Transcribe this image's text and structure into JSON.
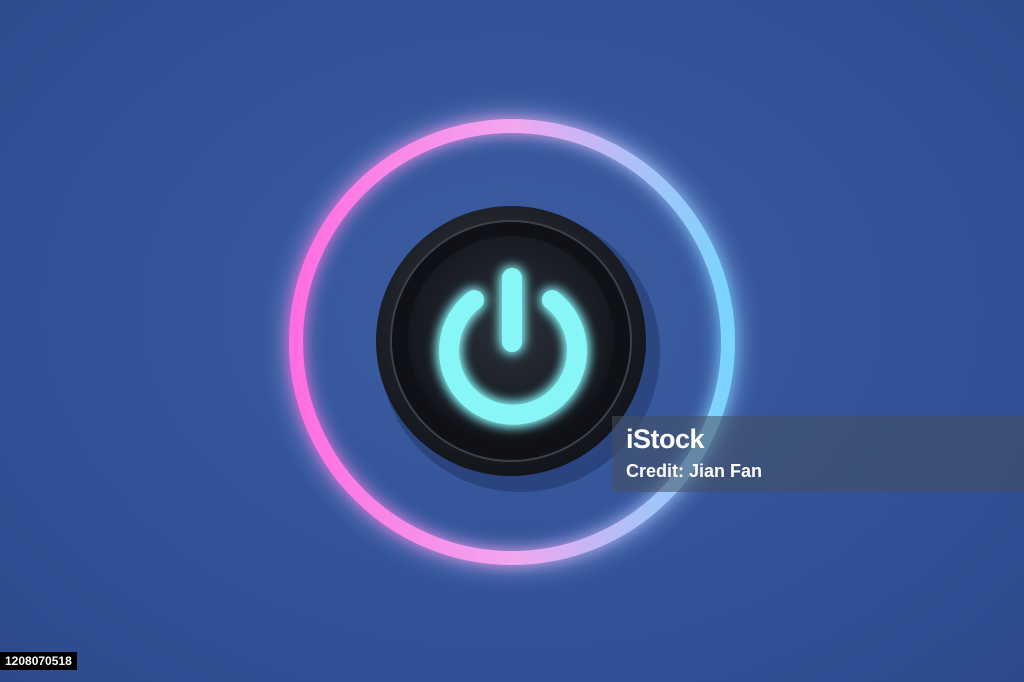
{
  "scene": {
    "subject": "power-button",
    "icon": "power-icon",
    "colors": {
      "background": "#34549a",
      "ring_pink": "#ff7fe3",
      "ring_blue": "#7fd8ff",
      "button_body": "#1a1d24",
      "icon_glow": "#7ff3f5"
    }
  },
  "watermark": {
    "logo": "iStock",
    "credit": "Credit: Jian Fan"
  },
  "image_id": "1208070518"
}
